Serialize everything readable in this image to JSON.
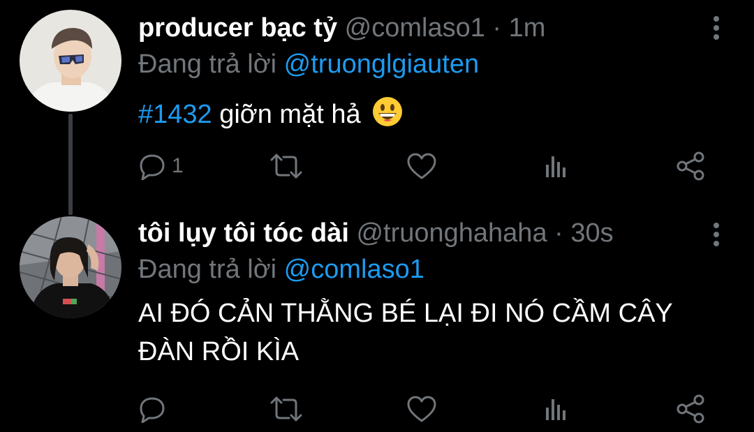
{
  "colors": {
    "background": "#000000",
    "primary_text": "#ffffff",
    "secondary_text": "#71767b",
    "link": "#1d9bf0",
    "thread_line": "#3a3d41"
  },
  "tweets": [
    {
      "display_name": "producer bạc tỷ",
      "handle": "@comlaso1",
      "separator": "·",
      "time": "1m",
      "reply_prefix": "Đang trả lời",
      "reply_to": "@truonglgiauten",
      "hashtag": "#1432",
      "text": "giỡn mặt hả",
      "emoji": "grinning-face-emoji",
      "reply_count": "1",
      "icons": [
        "reply-icon",
        "retweet-icon",
        "like-icon",
        "views-icon",
        "share-icon",
        "more-icon"
      ]
    },
    {
      "display_name": "tôi lụy tôi tóc dài",
      "handle": "@truonghahaha",
      "separator": "·",
      "time": "30s",
      "reply_prefix": "Đang trả lời",
      "reply_to": "@comlaso1",
      "text": "AI ĐÓ CẢN THẰNG BÉ LẠI ĐI NÓ CẦM CÂY ĐÀN RỒI KÌA",
      "icons": [
        "reply-icon",
        "retweet-icon",
        "like-icon",
        "views-icon",
        "share-icon",
        "more-icon"
      ]
    }
  ]
}
